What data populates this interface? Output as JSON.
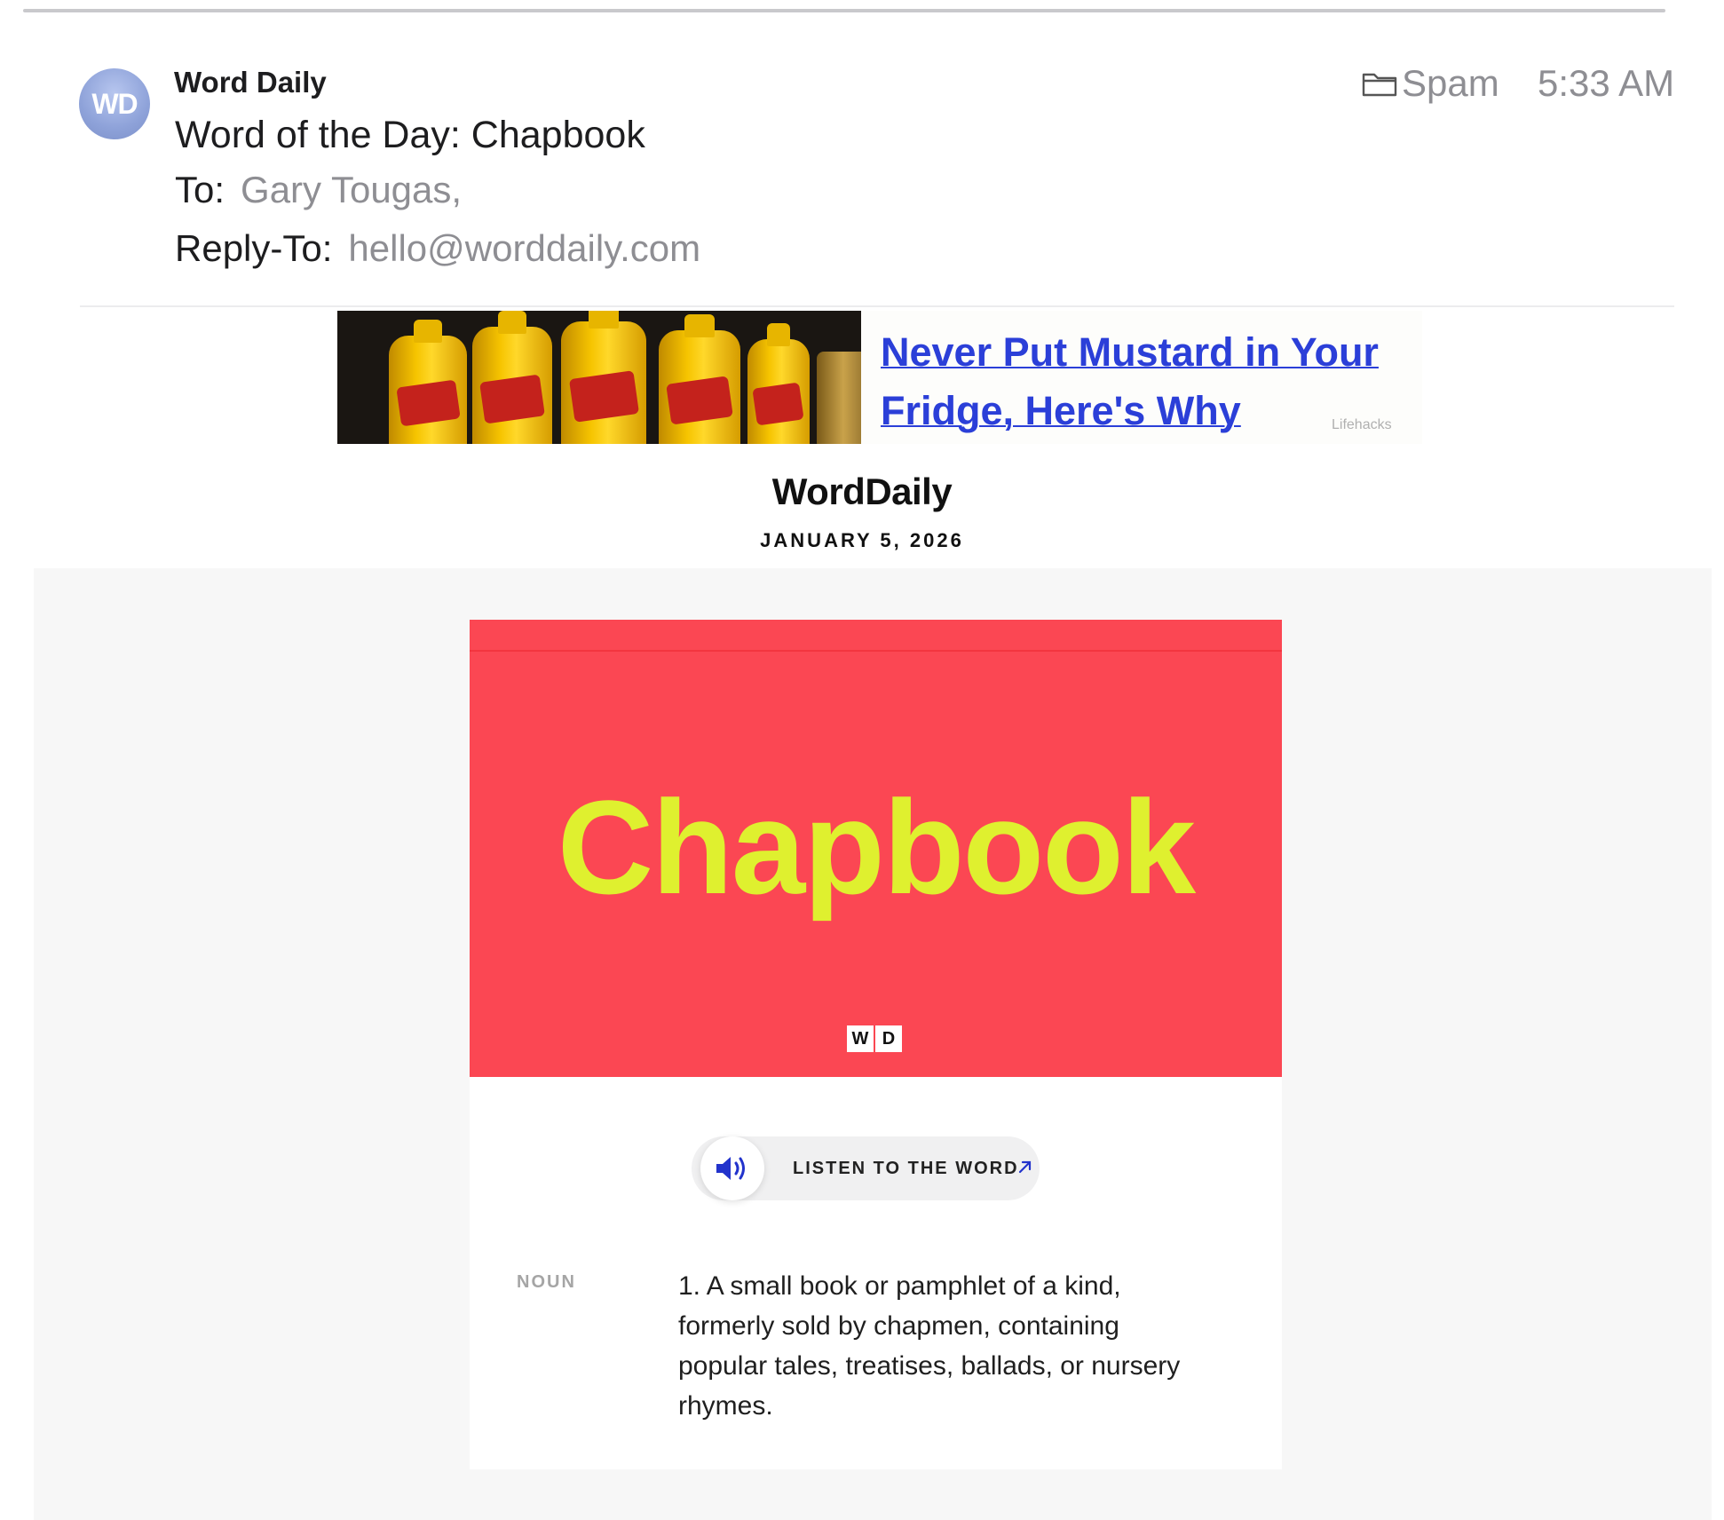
{
  "email": {
    "avatar_initials": "WD",
    "sender": "Word Daily",
    "subject": "Word of the Day: Chapbook",
    "to_label": "To:",
    "to_value": "Gary Tougas,",
    "reply_to_label": "Reply-To:",
    "reply_to_value": "hello@worddaily.com",
    "folder": "Spam",
    "time": "5:33 AM"
  },
  "ad": {
    "title": "Never Put Mustard in Your Fridge, Here's Why",
    "source": "Lifehacks"
  },
  "newsletter": {
    "logo": "WordDaily",
    "date": "JANUARY 5, 2026",
    "word": "Chapbook",
    "mark_letters": [
      "W",
      "D"
    ],
    "listen_label": "LISTEN TO THE WORD",
    "part_of_speech": "NOUN",
    "definition": "1. A small book or pamphlet of a kind, formerly sold by chapmen, containing popular tales, treatises, ballads, or nursery rhymes."
  },
  "icons": {
    "folder": "folder-icon",
    "speaker": "speaker-icon",
    "arrow": "arrow-up-right-icon"
  },
  "colors": {
    "hero_background": "#fb4753",
    "hero_word": "#dff02f",
    "ad_link": "#2b3fd8",
    "speaker_icon": "#2233cc",
    "avatar": "#8ea2d9"
  }
}
